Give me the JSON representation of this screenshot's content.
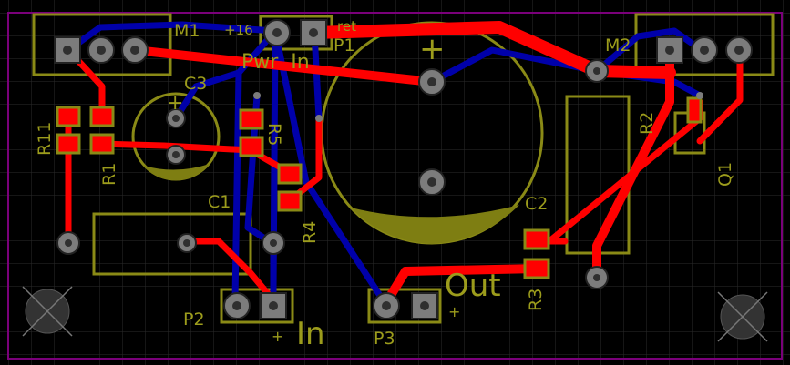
{
  "colors": {
    "background": "#000000",
    "grid": "#2b2b2b",
    "outline": "#7a007a",
    "top_copper": "#ff0000",
    "bottom_copper": "#0000aa",
    "silkscreen": "#8a8a16",
    "pad": "#7c7c7c"
  },
  "labels": {
    "M1": "M1",
    "M2": "M2",
    "P1": "P1",
    "P2": "P2",
    "P3": "P3",
    "C1": "C1",
    "C2": "C2",
    "C3": "C3",
    "R1": "R1",
    "R2": "R2",
    "R3": "R3",
    "R4": "R4",
    "R5": "R5",
    "R11": "R11",
    "Q1": "Q1",
    "plus16": "+16",
    "ret": "ret",
    "pwr_in": "Pwr  In",
    "out": "Out",
    "in": "In",
    "plus_p2": "+",
    "plus_p3": "+",
    "plus_c3": "+",
    "plus_big_cap": "+"
  }
}
